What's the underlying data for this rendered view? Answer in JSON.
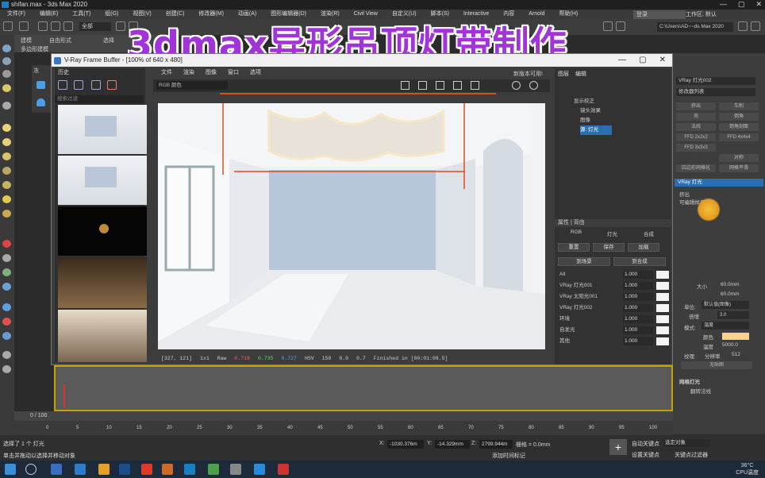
{
  "app": {
    "title": "shifan.max - 3ds Max 2020",
    "menu": [
      "文件(F)",
      "编辑(E)",
      "工具(T)",
      "组(G)",
      "视图(V)",
      "创建(C)",
      "修改器(M)",
      "动画(A)",
      "图形编辑器(D)",
      "渲染(R)",
      "Civil View",
      "自定义(U)",
      "脚本(S)",
      "Interactive",
      "内容",
      "Arnold",
      "帮助(H)"
    ],
    "user": "登录",
    "workspace_label": "工作区:",
    "workspace_value": "默认",
    "path": "C:\\Users\\AD~~ds Max 2020",
    "ribbon_a": "建模",
    "ribbon_b": "自由形式",
    "ribbon_c": "选择",
    "ribbon_d": "多边形建模",
    "toolbar_sel": "全部"
  },
  "overlay_title": "3dmax异形吊顶灯带制作",
  "vfb": {
    "title": "V-Ray Frame Buffer - [100% of 640 x 480]",
    "history_label": "历史",
    "search_placeholder": "搜索过滤",
    "menu": [
      "文件",
      "渲染",
      "图像",
      "窗口",
      "选项"
    ],
    "channel": "RGB 颜色",
    "update_label": "新版本可用!",
    "status": {
      "coords": "[327, 121]",
      "ratio": "1x1",
      "raw": "Raw",
      "r": "0.719",
      "g": "0.735",
      "b": "0.727",
      "mode": "HSV",
      "h": "150",
      "s": "0.0",
      "v": "0.7",
      "finished": "Finished in [00:01:08.5]"
    }
  },
  "layers": {
    "tab_layers": "图层",
    "tab_edit": "编辑",
    "tree": [
      "显示校正",
      "镜头效果",
      "图像",
      "源: 灯光"
    ],
    "section": "属性 | 背由",
    "modes": [
      "RGB",
      "灯光",
      "合成"
    ],
    "buttons": [
      "重置",
      "保存",
      "加载"
    ],
    "btn_to_scene": "到场景",
    "btn_to_comp": "到合成",
    "rows": [
      {
        "label": "All",
        "value": "1.000"
      },
      {
        "label": "VRay 灯光001",
        "value": "1.000"
      },
      {
        "label": "VRay 太阳光001",
        "value": "1.000"
      },
      {
        "label": "VRay 灯光002",
        "value": "1.000"
      },
      {
        "label": "环境",
        "value": "1.000"
      },
      {
        "label": "自发光",
        "value": "1.000"
      },
      {
        "label": "其他",
        "value": "1.000"
      }
    ]
  },
  "cmd": {
    "object_name": "VRay 灯光002",
    "modlist": "修改器列表",
    "stack_selected": "VRay 灯光",
    "stack_1": "挤出",
    "stack_2": "可编辑样条线",
    "btns": [
      "挤出",
      "车削",
      "壳",
      "倒角",
      "法线",
      "倒角剖面",
      "FFD 2x2x2",
      "FFD 4x4x4",
      "FFD 3x3x3",
      "四边形网格化",
      "对称",
      "网格平滑"
    ],
    "unit_label": "单位:",
    "unit_value": "默认值(图像)",
    "mult_label": "倍增",
    "mult_value": "3.0",
    "mode_label": "模式:",
    "mode_value": "温度",
    "color_label": "颜色",
    "temp_label": "温度",
    "temp_value": "5000.0",
    "tex_label": "纹理",
    "res_label": "分辨率",
    "res_value": "512",
    "none_label": "无贴图",
    "grid_label": "网格灯光",
    "grid_item": "翻转法线",
    "size_l": "大小",
    "size_v1": "60.0mm",
    "size_v2": "60.0mm"
  },
  "timeline": {
    "frame": "0 / 100"
  },
  "ruler_ticks": [
    "0",
    "5",
    "10",
    "15",
    "20",
    "25",
    "30",
    "35",
    "40",
    "45",
    "50",
    "55",
    "60",
    "65",
    "70",
    "75",
    "80",
    "85",
    "90",
    "95",
    "100"
  ],
  "status": {
    "selected": "选择了 1 个 灯光",
    "hint": "单击并拖动以选择并移动对象",
    "x_label": "X:",
    "x": "-1030.376m",
    "y_label": "Y:",
    "y": "-14.329mm",
    "z_label": "Z:",
    "z": "2799.944m",
    "grid": "栅格 = 0.0mm",
    "autokey": "自动关键点",
    "setkey": "设置关键点",
    "selobj": "选定对象",
    "filter": "关键点过滤器",
    "addtag": "添加时间标记"
  },
  "taskbar": {
    "temp": "36°C",
    "cpu": "CPU温度"
  }
}
